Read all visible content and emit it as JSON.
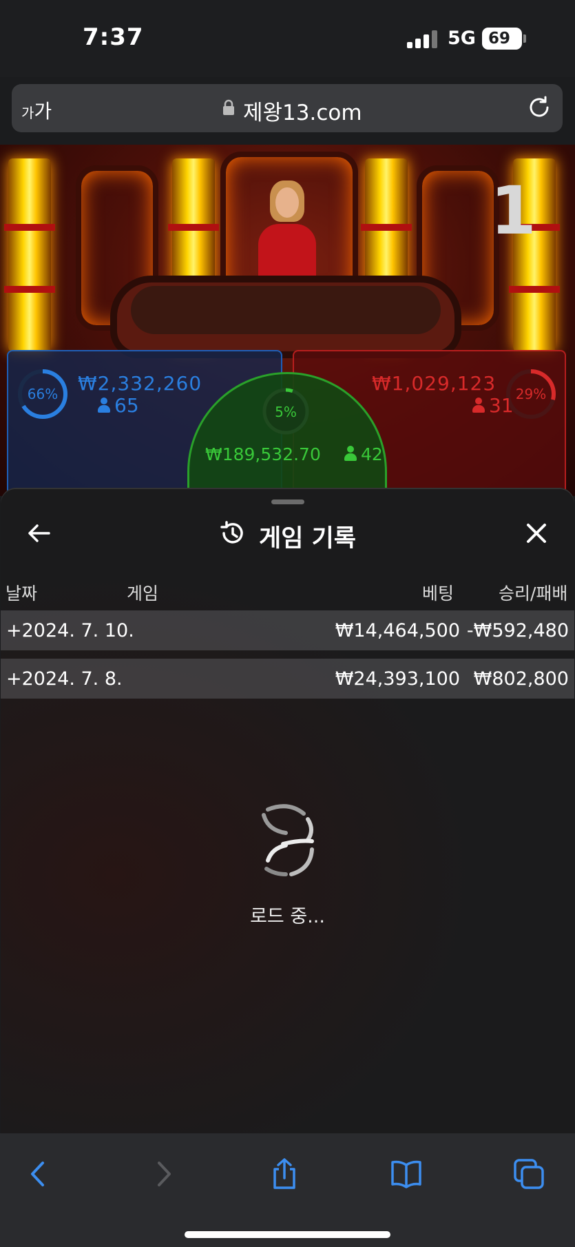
{
  "status_bar": {
    "time": "7:37",
    "network": "5G",
    "battery": "69"
  },
  "address_bar": {
    "text_size_label_small": "가",
    "text_size_label": "가",
    "url": "제왕13.com"
  },
  "game": {
    "round_number": "1",
    "player": {
      "percent": "66%",
      "amount": "₩2,332,260",
      "players": "65"
    },
    "banker": {
      "percent": "29%",
      "amount": "₩1,029,123",
      "players": "31"
    },
    "tie": {
      "percent": "5%",
      "amount": "₩189,532.70",
      "players": "42"
    }
  },
  "history_panel": {
    "title": "게임 기록",
    "columns": {
      "date": "날짜",
      "game": "게임",
      "bet": "베팅",
      "win_loss": "승리/패배"
    },
    "rows": [
      {
        "date": "+2024. 7. 10.",
        "bet": "₩14,464,500",
        "win_loss": "-₩592,480"
      },
      {
        "date": "+2024. 7. 8.",
        "bet": "₩24,393,100",
        "win_loss": "₩802,800"
      }
    ],
    "loading_text": "로드 중..."
  },
  "toolbar": {
    "icons": [
      "back-icon",
      "forward-icon",
      "share-icon",
      "bookmarks-icon",
      "tabs-icon"
    ]
  },
  "colors": {
    "player_blue": "#2a7fe0",
    "banker_red": "#d82a2a",
    "tie_green": "#39c839",
    "toolbar_blue": "#3c8ef0"
  }
}
